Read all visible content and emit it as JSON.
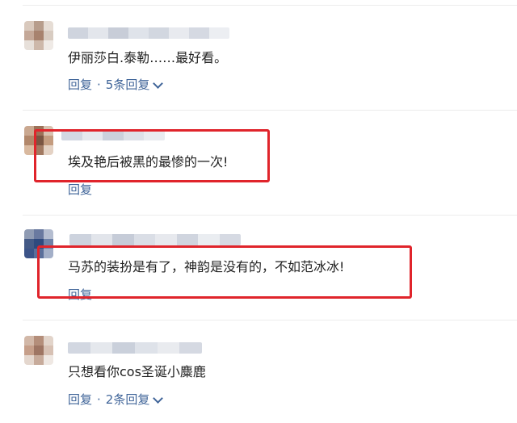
{
  "comments": [
    {
      "text": "伊丽莎白.泰勒……最好看。",
      "reply_label": "回复",
      "replies_count_label": "5条回复"
    },
    {
      "text": "埃及艳后被黑的最惨的一次!",
      "reply_label": "回复"
    },
    {
      "text": "马苏的装扮是有了，神韵是没有的，不如范冰冰!",
      "reply_label": "回复"
    },
    {
      "text": "只想看你cos圣诞小麋鹿",
      "reply_label": "回复",
      "replies_count_label": "2条回复"
    }
  ],
  "colors": {
    "highlight_box": "#e0242b",
    "link": "#406599"
  }
}
